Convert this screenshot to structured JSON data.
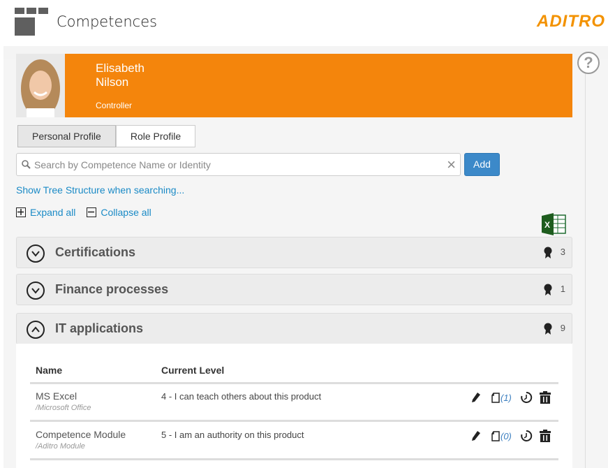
{
  "header": {
    "title": "Competences",
    "brand": "ADITRO"
  },
  "profile": {
    "first_name": "Elisabeth",
    "last_name": "Nilson",
    "role": "Controller"
  },
  "tabs": [
    {
      "label": "Personal Profile",
      "active": true
    },
    {
      "label": "Role Profile",
      "active": false
    }
  ],
  "search": {
    "placeholder": "Search by Competence Name or Identity",
    "value": "",
    "add_label": "Add"
  },
  "tree_link": "Show Tree Structure when searching...",
  "expand_all": "Expand all",
  "collapse_all": "Collapse all",
  "colors": {
    "accent": "#f4850c",
    "brand": "#f39200",
    "button": "#3c89c9",
    "link": "#1a8ac6"
  },
  "sections": [
    {
      "title": "Certifications",
      "count": "3",
      "expanded": false
    },
    {
      "title": "Finance processes",
      "count": "1",
      "expanded": false
    },
    {
      "title": "IT applications",
      "count": "9",
      "expanded": true
    }
  ],
  "table": {
    "columns": [
      "Name",
      "Current Level"
    ],
    "rows": [
      {
        "name": "MS Excel",
        "path": "/Microsoft Office",
        "level": "4 - I can teach others about this product",
        "copies": "(1)"
      },
      {
        "name": "Competence Module",
        "path": "/Aditro Module",
        "level": "5 - I am an authority on this product",
        "copies": "(0)"
      }
    ]
  }
}
